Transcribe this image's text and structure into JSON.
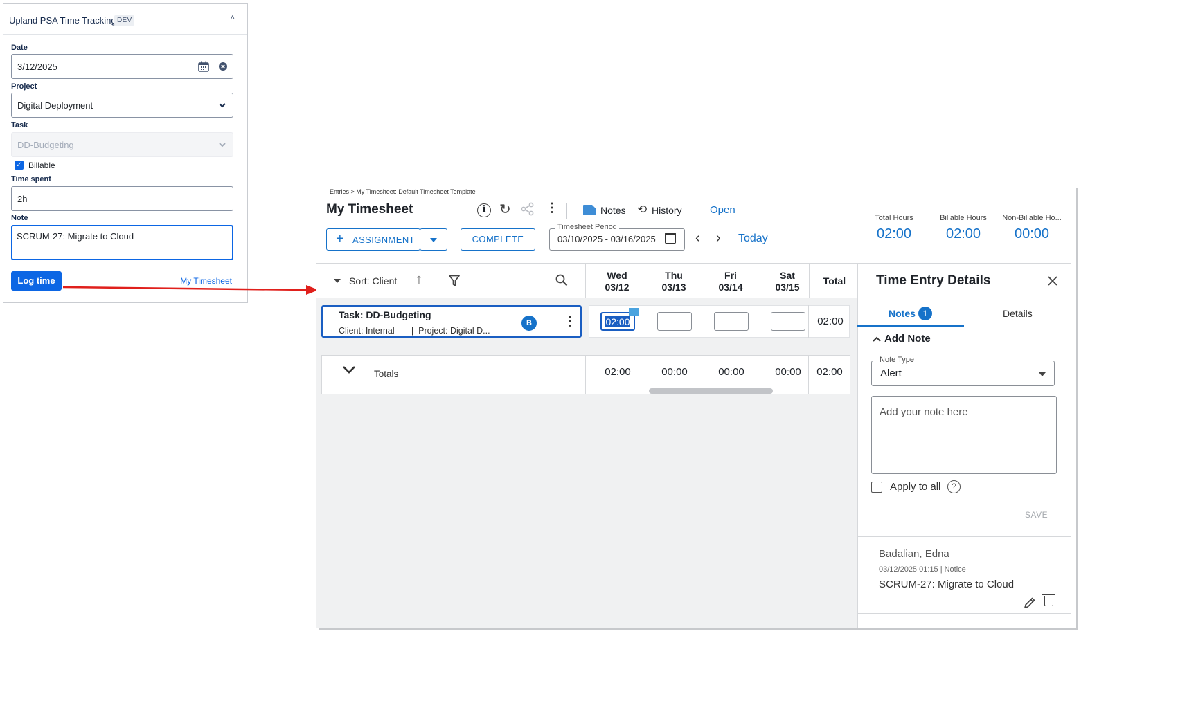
{
  "plugin": {
    "title": "Upland PSA Time Tracking",
    "badge": "DEV",
    "fields": {
      "date": {
        "label": "Date",
        "value": "3/12/2025"
      },
      "project": {
        "label": "Project",
        "value": "Digital Deployment"
      },
      "task": {
        "label": "Task",
        "value": "DD-Budgeting"
      },
      "billable": {
        "label": "Billable",
        "checked": true
      },
      "time_spent": {
        "label": "Time spent",
        "value": "2h"
      },
      "note": {
        "label": "Note",
        "value": "SCRUM-27: Migrate to Cloud"
      }
    },
    "log_button": "Log time",
    "my_timesheet_link": "My Timesheet"
  },
  "timesheet": {
    "breadcrumb": "Entries > My Timesheet: Default Timesheet Template",
    "title": "My Timesheet",
    "toolbar": {
      "notes": "Notes",
      "history": "History",
      "status": "Open"
    },
    "assignment_button": "ASSIGNMENT",
    "complete_button": "COMPLETE",
    "period_label": "Timesheet Period",
    "period_value": "03/10/2025 - 03/16/2025",
    "today": "Today",
    "summary": [
      {
        "label": "Total Hours",
        "value": "02:00"
      },
      {
        "label": "Billable Hours",
        "value": "02:00"
      },
      {
        "label": "Non-Billable Ho...",
        "value": "00:00"
      }
    ],
    "sort_label": "Sort: Client",
    "days": [
      {
        "day": "Wed",
        "date": "03/12"
      },
      {
        "day": "Thu",
        "date": "03/13"
      },
      {
        "day": "Fri",
        "date": "03/14"
      },
      {
        "day": "Sat",
        "date": "03/15"
      }
    ],
    "total_header": "Total",
    "row": {
      "task": "Task: DD-Budgeting",
      "meta": "Client: Internal       |  Project: Digital D...",
      "badge": "B",
      "cells": [
        "02:00",
        "",
        "",
        ""
      ],
      "total": "02:00"
    },
    "totals": {
      "label": "Totals",
      "values": [
        "02:00",
        "00:00",
        "00:00",
        "00:00"
      ],
      "total": "02:00"
    }
  },
  "details_panel": {
    "title": "Time Entry Details",
    "tabs": {
      "notes": "Notes",
      "notes_count": "1",
      "details": "Details"
    },
    "add_note": "Add Note",
    "note_type_label": "Note Type",
    "note_type_value": "Alert",
    "note_placeholder": "Add your note here",
    "apply_to_all": "Apply to all",
    "save": "SAVE",
    "existing_note": {
      "author": "Badalian, Edna",
      "meta": "03/12/2025 01:15 | Notice",
      "text": "SCRUM-27: Migrate to Cloud"
    }
  },
  "colors": {
    "accent": "#1672c9",
    "jira_blue": "#0c66e4",
    "arrow": "#e0201c"
  }
}
